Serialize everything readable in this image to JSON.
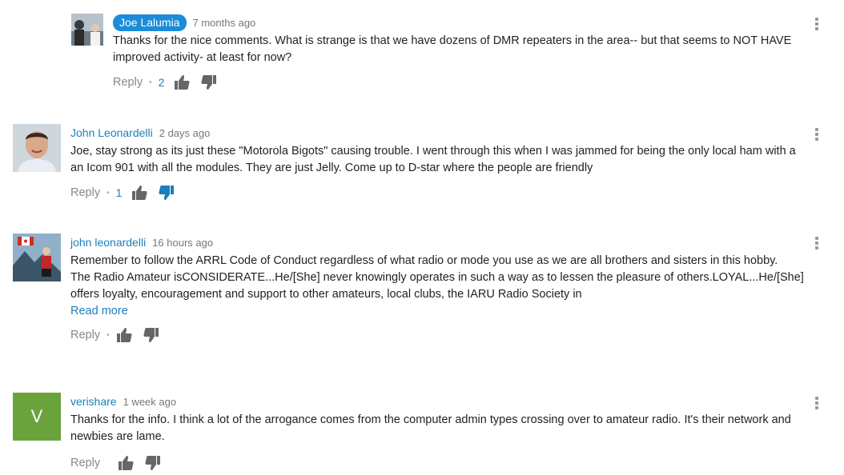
{
  "comments": [
    {
      "author": "Joe Lalumia",
      "time": "7 months ago",
      "text": "Thanks for the nice comments. What is strange is that we have dozens of DMR repeaters in the area-- but that seems to NOT HAVE improved activity- at least for now?",
      "reply": "Reply",
      "dot": "•",
      "likes": "2"
    },
    {
      "author": "John Leonardelli",
      "time": "2 days ago",
      "text": "Joe, stay strong as its just these \"Motorola Bigots\" causing trouble. I went through this when I was jammed for being the only local ham with a an Icom 901 with all the modules. They are just Jelly. Come up to D-star where the people are friendly",
      "reply": "Reply",
      "dot": "•",
      "likes": "1"
    },
    {
      "author": "john leonardelli",
      "time": "16 hours ago",
      "text1": "Remember to follow the ARRL Code of Conduct regardless of what radio or mode you use as we are all brothers and sisters in this hobby.",
      "text2": "The Radio Amateur isCONSIDERATE...He/[She] never knowingly operates in such a way as to lessen the pleasure of others.LOYAL...He/[She] offers loyalty, encouragement and support to other amateurs, local clubs, the IARU Radio Society in",
      "read_more": "Read more",
      "reply": "Reply",
      "dot": "•"
    },
    {
      "author": "verishare",
      "time": "1 week ago",
      "avatar_letter": "V",
      "text": "Thanks for the info. I think a lot of the arrogance comes from the computer admin types crossing over to amateur radio. It's their network and newbies are lame.",
      "reply": "Reply"
    }
  ],
  "colors": {
    "link": "#1b7ebf",
    "owner_badge": "#1a8cd8",
    "muted": "#888888",
    "v_avatar": "#6aa33b"
  }
}
